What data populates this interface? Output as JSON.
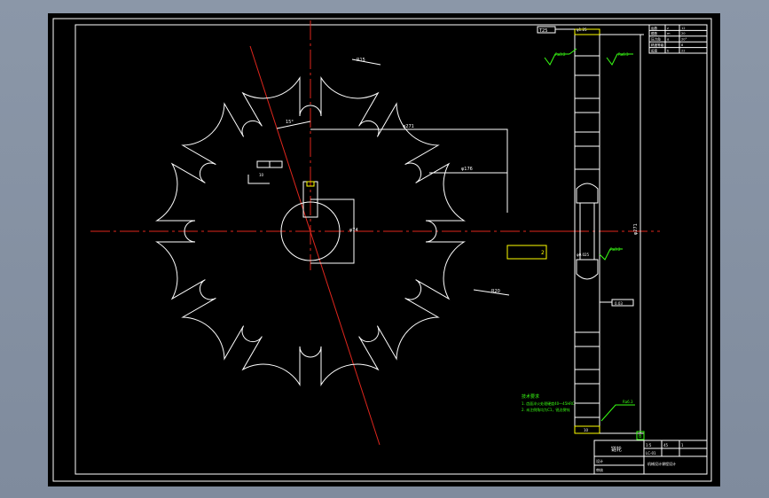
{
  "front_view": {
    "dim_radius_top": "R15",
    "dim_angle": "15°",
    "dim_outer": "φ271",
    "dim_mid": "φ176",
    "dim_bore": "φ74",
    "dim_key": "10",
    "dim_radius_right": "R20",
    "dim_yellow": "2"
  },
  "side_view": {
    "top_tolerance": "φ1.25",
    "top_left_marker": "T25",
    "roughness_left": "Ra3.2",
    "roughness_right": "Ra6.3",
    "bore_tolerance": "φ0.025",
    "roughness_bore": "Ra3.2",
    "height_dim": "φ271",
    "callout": "0.03",
    "bottom_dim": "10",
    "bottom_label": "Ra6.3",
    "datum": "B"
  },
  "notes": {
    "heading": "技术要求",
    "line1": "1. 齿面淬火处理硬度40～45HRC",
    "line2": "2. 未注倒角均为C1，锐边倒钝"
  },
  "param_table": {
    "rows": [
      [
        "齿数",
        "z",
        "12"
      ],
      [
        "模数",
        "m",
        "20"
      ],
      [
        "压力角",
        "α",
        "20°"
      ],
      [
        "精度等级",
        "",
        "8"
      ],
      [
        "齿宽",
        "b",
        "22"
      ]
    ]
  },
  "title_block": {
    "part_name": "链轮",
    "scale": "1:5",
    "material": "45",
    "sheet": "1",
    "designer": "设计",
    "checker": "审核",
    "school": "机械设计课程设计",
    "drawing_no": "LC-01"
  }
}
